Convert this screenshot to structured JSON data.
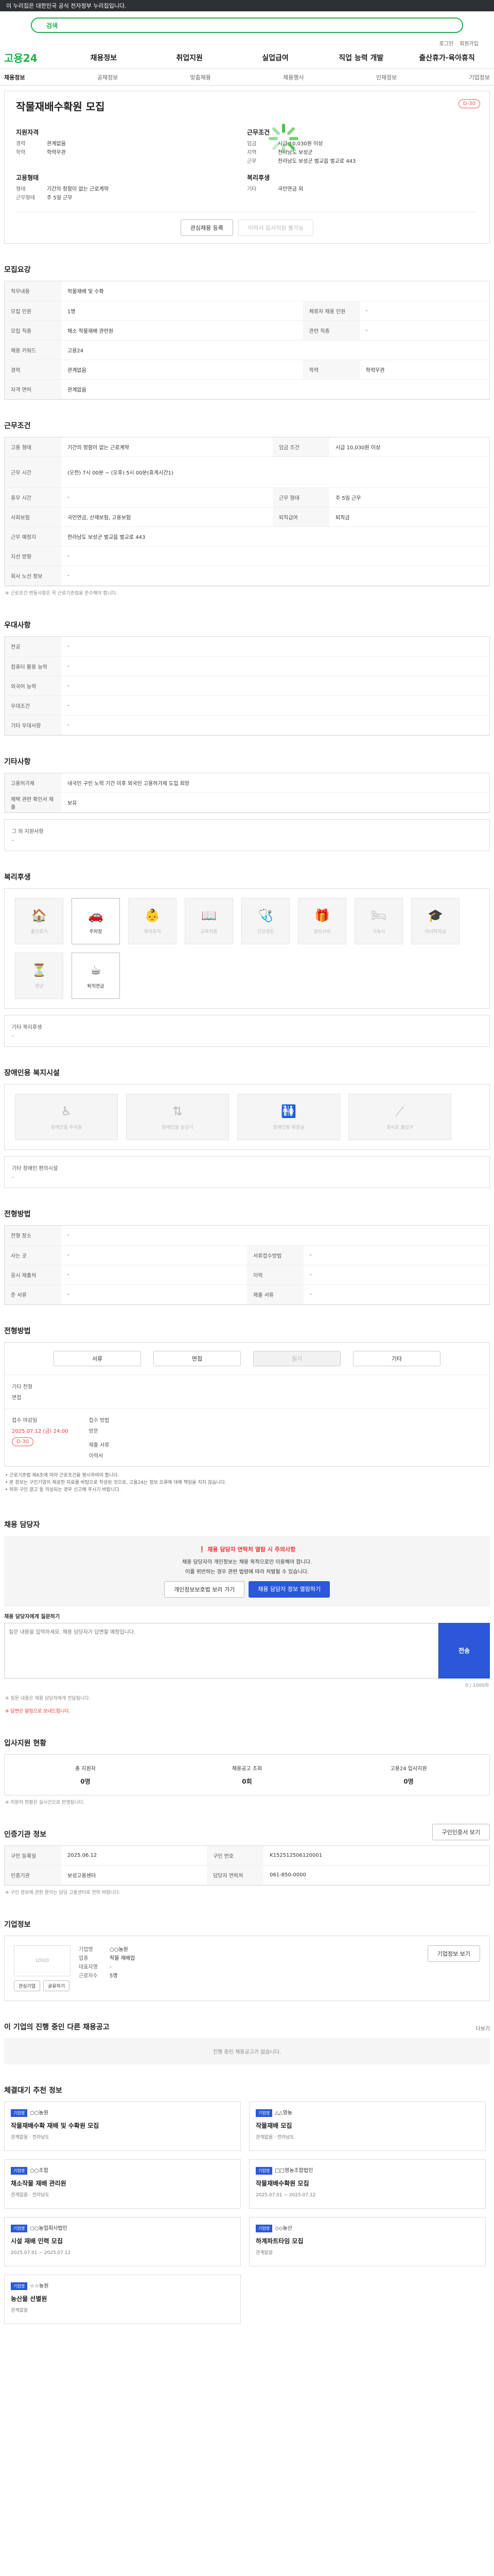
{
  "topbar": {
    "notice": "이 누리집은 대한민국 공식 전자정부 누리집입니다."
  },
  "search": {
    "label": "검색"
  },
  "util": [
    "로그인",
    "회원가입"
  ],
  "gnb": {
    "logo": "고용24",
    "items": [
      "채용정보",
      "취업지원",
      "실업급여",
      "직업 능력 개발",
      "출산휴가·육아휴직"
    ]
  },
  "lnb": [
    "채용정보",
    "공채정보",
    "맞춤채용",
    "채용행사",
    "인재정보",
    "기업정보"
  ],
  "hero": {
    "title": "작물재배수확원 모집",
    "badge": "D-30",
    "conditions_title": "지원자격",
    "conditions": [
      {
        "k": "경력",
        "v": "관계없음"
      },
      {
        "k": "학력",
        "v": "학력무관"
      }
    ],
    "work_title": "근무조건",
    "work": [
      {
        "k": "임금",
        "v": "시급 10,030원 이상"
      },
      {
        "k": "지역",
        "v": "전라남도 보성군"
      },
      {
        "k": "근무",
        "v": "전라남도 보성군 벌교읍 벌교로 443"
      }
    ],
    "employ_title": "고용형태",
    "employ": [
      {
        "k": "형태",
        "v": "기간의 정함이 없는 근로계약"
      },
      {
        "k": "근무형태",
        "v": "주 5일 근무"
      }
    ],
    "welfare_title": "복리후생",
    "welfare": [
      {
        "k": "기타",
        "v": "국민연금 외"
      }
    ],
    "btn_apply": "관심채용 등록",
    "btn_interest": "이력서 입사지원 불가능"
  },
  "recruit": {
    "title": "모집요강",
    "rows": [
      {
        "k": "직무내용",
        "v": "작물재배 및 수확"
      },
      {
        "k": "모집 인원",
        "v": "1명",
        "k2": "체류자 채용 인원",
        "v2": "-"
      },
      {
        "k": "모집 직종",
        "v": "채소 작물재배 관련원",
        "k2": "관련 직종",
        "v2": "-"
      },
      {
        "k": "채용 키워드",
        "v": "고용24"
      },
      {
        "k": "경력",
        "v": "관계없음",
        "k2": "학력",
        "v2": "학력무관"
      },
      {
        "k": "자격 면허",
        "v": "관계없음"
      }
    ]
  },
  "conditions": {
    "title": "근무조건",
    "rows": [
      {
        "k": "고용 형태",
        "v": "기간의 정함이 없는 근로계약",
        "k2": "임금 조건",
        "v2": "시급 10,030원 이상"
      },
      {
        "k": "근무 시간",
        "v": "(오전) 7시 00분 ~ (오후) 5시 00분(휴게시간1)"
      },
      {
        "k": "휴무 시간",
        "v": "-",
        "k2": "근무 형태",
        "v2": "주 5일 근무"
      },
      {
        "k": "사회보험",
        "v": "국민연금, 산재보험, 고용보험",
        "k2": "퇴직급여",
        "v2": "퇴직금"
      },
      {
        "k": "근무 예정지",
        "v": "전라남도 보성군 벌교읍 벌교로 443"
      },
      {
        "k": "지선 방향",
        "v": "-"
      },
      {
        "k": "회사 노선 정보",
        "v": "-"
      }
    ],
    "note": "※ 근로조건 변동사항은 꼭 근로기준법을 준수해야 합니다."
  },
  "preferred": {
    "title": "우대사항",
    "rows": [
      {
        "k": "전공",
        "v": "-"
      },
      {
        "k": "컴퓨터 활용 능력",
        "v": "-"
      },
      {
        "k": "외국어 능력",
        "v": "-"
      },
      {
        "k": "우대조건",
        "v": "-"
      },
      {
        "k": "기타 우대사항",
        "v": "-"
      }
    ]
  },
  "etc": {
    "title": "기타사항",
    "rows": [
      {
        "k": "고용허가제",
        "v": "내국인 구인 노력 기간 이후 외국인 고용허가제 도입 희망"
      },
      {
        "k": "채택 관련 확인서 제출",
        "v": "보유"
      }
    ],
    "extra_label": "그 외 지원사항",
    "extra": "-"
  },
  "welfare": {
    "title": "복리후생",
    "items": [
      {
        "label": "출산휴가",
        "icon": "🏠",
        "on": false
      },
      {
        "label": "주차장",
        "icon": "🚗",
        "on": true
      },
      {
        "label": "육아휴직",
        "icon": "👶",
        "on": false
      },
      {
        "label": "교육지원",
        "icon": "📖",
        "on": false
      },
      {
        "label": "건강검진",
        "icon": "🩺",
        "on": false
      },
      {
        "label": "경조사비",
        "icon": "🎁",
        "on": false
      },
      {
        "label": "기숙사",
        "icon": "🛏",
        "on": false
      },
      {
        "label": "자녀학자금",
        "icon": "🎓",
        "on": false
      },
      {
        "label": "정년",
        "icon": "⏳",
        "on": false
      },
      {
        "label": "퇴직연금",
        "icon": "☕",
        "on": true
      }
    ],
    "extra_label": "기타 복리후생",
    "extra": "-"
  },
  "disabled": {
    "title": "장애인용 복지시설",
    "items": [
      "장애인용 주차장",
      "장애인용 승강기",
      "장애인용 화장실",
      "경사로 출입구"
    ],
    "extra_label": "기타 장애인 편의시설",
    "extra": "-"
  },
  "method": {
    "title": "전형방법",
    "rows": [
      {
        "k": "전형 장소",
        "v": "-"
      },
      {
        "k": "사는 곳",
        "v": "-",
        "k2": "서류접수방법",
        "v2": "-"
      },
      {
        "k": "응시 제출처",
        "v": "-",
        "k2": "이력",
        "v2": "-"
      },
      {
        "k": "준 서류",
        "v": "-",
        "k2": "제출 서류",
        "v2": "-"
      }
    ]
  },
  "process": {
    "title": "전형방법",
    "steps": [
      {
        "label": "서류",
        "on": true
      },
      {
        "label": "면접",
        "on": true
      },
      {
        "label": "필기",
        "on": false
      },
      {
        "label": "기타",
        "on": true
      }
    ],
    "extra_label": "기타 전형",
    "extra": "면접",
    "deadline_label": "접수 마감일",
    "deadline": "2025.07.12 (금) 24:00",
    "dday": "D-30",
    "method_label": "접수 방법",
    "method": "방문",
    "doc_label": "제출 서류",
    "doc": "이력서"
  },
  "bullets": [
    "• 근로기준법 제6조에 따라 근로조건을 명시하여야 합니다.",
    "• 본 정보는 구인기업이 제공한 자료를 바탕으로 작성된 것으로, 고용24는 정보 오류에 대해 책임을 지지 않습니다.",
    "• 허위 구인 광고 등 의심되는 경우 신고해 주시기 바랍니다."
  ],
  "contact": {
    "title": "채용 담당자",
    "warn": "채용 담당자 연락처 열람 시 주의사항",
    "desc1": "채용 담당자의 개인정보는 채용 목적으로만 이용해야 합니다.",
    "desc2": "이를 위반하는 경우 관련 법령에 따라 처벌될 수 있습니다.",
    "btn1": "개인정보보호법 보러 가기",
    "btn2": "채용 담당자 정보 열람하기"
  },
  "qna": {
    "title": "채용 담당자에게 질문하기",
    "placeholder": "질문 내용을 입력하세요. 채용 담당자가 답변할 예정입니다.",
    "btn": "전송",
    "counter": "0 / 1000자",
    "notes": [
      "※ 질문 내용은 채용 담당자에게 전달됩니다.",
      "※ 답변은 알림으로 보내드립니다."
    ]
  },
  "applicants": {
    "title": "입사지원 현황",
    "items": [
      {
        "label": "총 지원자",
        "value": "0명"
      },
      {
        "label": "채용공고 조회",
        "value": "0회"
      },
      {
        "label": "고용24 입사지원",
        "value": "0명"
      }
    ],
    "note": "※ 지원자 현황은 실시간으로 반영됩니다."
  },
  "register": {
    "title": "인증기관 정보",
    "btn": "구인인증서 보기",
    "rows": [
      {
        "k": "구인 등록일",
        "v": "2025.06.12",
        "k2": "구인 번호",
        "v2": "K152512506120001"
      },
      {
        "k": "인증기관",
        "v": "보성고용센터",
        "k2": "담당자 연락처",
        "v2": "061-850-0000"
      }
    ],
    "note": "※ 구인 정보에 관한 문의는 담당 고용센터로 연락 바랍니다."
  },
  "company": {
    "title": "기업정보",
    "logo": "LOGO",
    "rows": [
      {
        "k": "기업명",
        "v": "○○농원"
      },
      {
        "k": "업종",
        "v": "작물 재배업"
      },
      {
        "k": "대표자명",
        "v": "-"
      },
      {
        "k": "근로자수",
        "v": "5명"
      }
    ],
    "btn": "기업정보 보기",
    "btns": [
      "관심기업",
      "공유하기"
    ]
  },
  "other": {
    "title": "이 기업의 진행 중인 다른 채용공고",
    "text": "진행 중인 채용공고가 없습니다.",
    "more": "더보기"
  },
  "similar": {
    "title": "체결대기 추천 정보",
    "jobs": [
      {
        "tag": "기업명",
        "co": "○○농원",
        "title": "작물재배수확 재배 및 수확원 모집",
        "meta": "관계없음 · 전라남도"
      },
      {
        "tag": "기업명",
        "co": "△△영농",
        "title": "작물재배 모집",
        "meta": "관계없음 · 전라남도"
      },
      {
        "tag": "기업명",
        "co": "○○조합",
        "title": "채소작물 재배 관리원",
        "meta": "관계없음 · 전라남도"
      },
      {
        "tag": "기업명",
        "co": "□□영농조합법인",
        "title": "작물재배수확원 모집",
        "meta": "2025.07.01 ~ 2025.07.12"
      },
      {
        "tag": "기업명",
        "co": "○○농업회사법인",
        "title": "시설 재배 인력 모집",
        "meta": "2025.07.01 ~ 2025.07.12"
      },
      {
        "tag": "기업명",
        "co": "◇◇농산",
        "title": "하계파트타임 모집",
        "meta": "관계없음"
      },
      {
        "tag": "기업명",
        "co": "☆☆농원",
        "title": "농산물 선별원",
        "meta": "관계없음"
      }
    ]
  }
}
